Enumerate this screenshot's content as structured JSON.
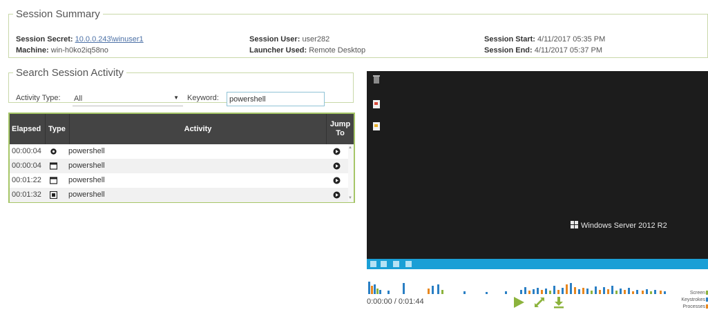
{
  "summary": {
    "legend": "Session Summary",
    "secret_label": "Session Secret:",
    "secret_value": "10.0.0.243\\winuser1",
    "machine_label": "Machine:",
    "machine_value": "win-h0ko2iq58no",
    "user_label": "Session User:",
    "user_value": "user282",
    "launcher_label": "Launcher Used:",
    "launcher_value": "Remote Desktop",
    "start_label": "Session Start:",
    "start_value": "4/11/2017 05:35 PM",
    "end_label": "Session End:",
    "end_value": "4/11/2017 05:37 PM"
  },
  "search": {
    "legend": "Search Session Activity",
    "activity_type_label": "Activity Type:",
    "activity_type_value": "All",
    "keyword_label": "Keyword:",
    "keyword_value": "powershell"
  },
  "table": {
    "headers": {
      "elapsed": "Elapsed",
      "type": "Type",
      "activity": "Activity",
      "jump": "Jump To"
    },
    "rows": [
      {
        "elapsed": "00:00:04",
        "type_icon": "gear-icon",
        "activity": "powershell"
      },
      {
        "elapsed": "00:00:04",
        "type_icon": "window-icon",
        "activity": "powershell"
      },
      {
        "elapsed": "00:01:22",
        "type_icon": "window-icon",
        "activity": "powershell"
      },
      {
        "elapsed": "00:01:32",
        "type_icon": "close-box-icon",
        "activity": "powershell"
      }
    ]
  },
  "player": {
    "brand": "Windows Server 2012 R2",
    "time_display": "0:00:00 / 0:01:44",
    "timeline_colors": {
      "primary": "#2a7fc4",
      "secondary": "#e8871e",
      "tertiary": "#8cb33d"
    },
    "legend_items": [
      "Screen",
      "Keystrokes",
      "Processes"
    ]
  },
  "colors": {
    "accent": "#8cb33d",
    "header_bg": "#444444",
    "border": "#a6c667"
  }
}
